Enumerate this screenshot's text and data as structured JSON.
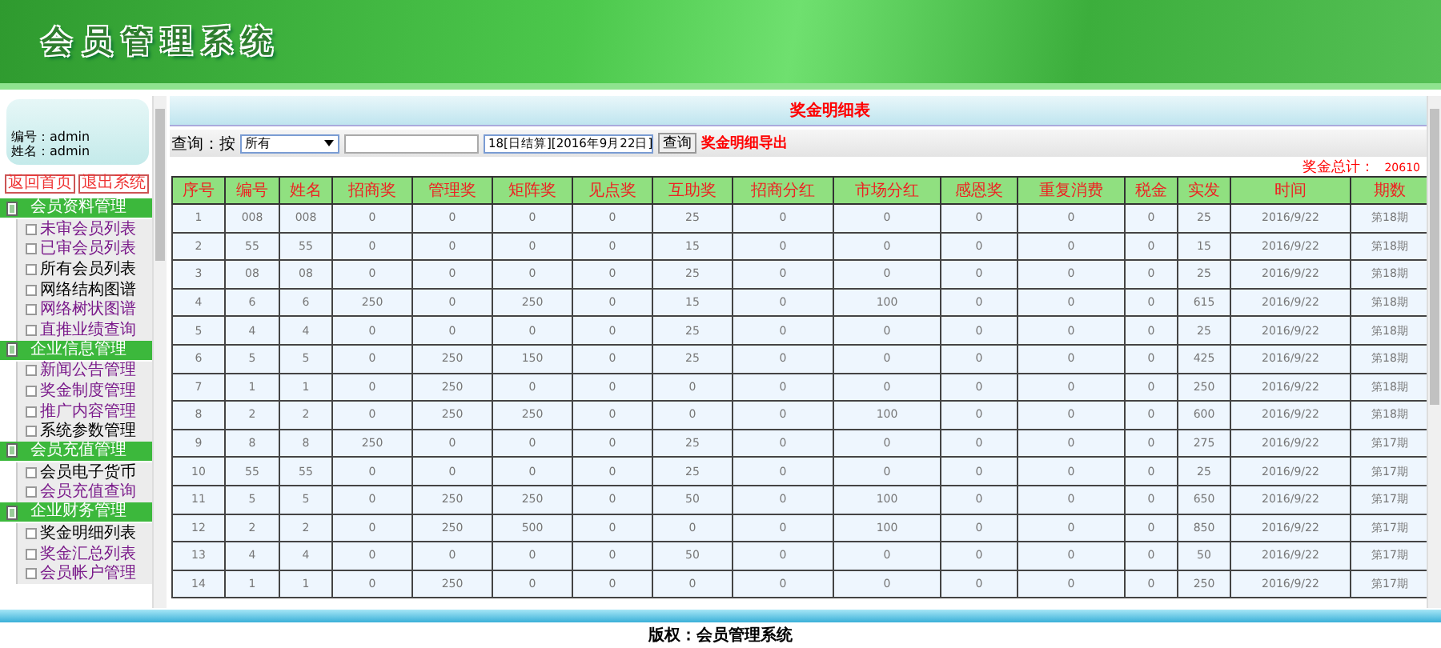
{
  "header": {
    "title": "会员管理系统"
  },
  "sidebar": {
    "user_lines": [
      "编号：admin",
      "姓名：admin"
    ],
    "buttons": [
      "返回首页",
      "退出系统"
    ],
    "groups": [
      {
        "title": "会员资料管理",
        "items": [
          {
            "label": "未审会员列表",
            "visited": true
          },
          {
            "label": "已审会员列表",
            "visited": true
          },
          {
            "label": "所有会员列表",
            "visited": false
          },
          {
            "label": "网络结构图谱",
            "visited": false
          },
          {
            "label": "网络树状图谱",
            "visited": true
          },
          {
            "label": "直推业绩查询",
            "visited": true
          }
        ]
      },
      {
        "title": "企业信息管理",
        "items": [
          {
            "label": "新闻公告管理",
            "visited": true
          },
          {
            "label": "奖金制度管理",
            "visited": true
          },
          {
            "label": "推广内容管理",
            "visited": true
          },
          {
            "label": "系统参数管理",
            "visited": false
          }
        ]
      },
      {
        "title": "会员充值管理",
        "items": [
          {
            "label": "会员电子货币",
            "visited": false
          },
          {
            "label": "会员充值查询",
            "visited": true
          }
        ]
      },
      {
        "title": "企业财务管理",
        "items": [
          {
            "label": "奖金明细列表",
            "visited": false
          },
          {
            "label": "奖金汇总列表",
            "visited": true
          },
          {
            "label": "会员帐户管理",
            "visited": true
          }
        ]
      }
    ]
  },
  "panel": {
    "title": "奖金明细表",
    "filter": {
      "label": "查询：按",
      "field_select": "所有",
      "period_select": "18[日结算][2016年9月22日]",
      "query_button": "查询",
      "export_link": "奖金明细导出"
    },
    "total": {
      "label": "奖金总计：",
      "value": "20610"
    },
    "table": {
      "columns": [
        "序号",
        "编号",
        "姓名",
        "招商奖",
        "管理奖",
        "矩阵奖",
        "见点奖",
        "互助奖",
        "招商分红",
        "市场分红",
        "感恩奖",
        "重复消费",
        "税金",
        "实发",
        "时间",
        "期数"
      ],
      "rows": [
        [
          "1",
          "008",
          "008",
          "0",
          "0",
          "0",
          "0",
          "25",
          "0",
          "0",
          "0",
          "0",
          "0",
          "25",
          "2016/9/22",
          "第18期"
        ],
        [
          "2",
          "55",
          "55",
          "0",
          "0",
          "0",
          "0",
          "15",
          "0",
          "0",
          "0",
          "0",
          "0",
          "15",
          "2016/9/22",
          "第18期"
        ],
        [
          "3",
          "08",
          "08",
          "0",
          "0",
          "0",
          "0",
          "25",
          "0",
          "0",
          "0",
          "0",
          "0",
          "25",
          "2016/9/22",
          "第18期"
        ],
        [
          "4",
          "6",
          "6",
          "250",
          "0",
          "250",
          "0",
          "15",
          "0",
          "100",
          "0",
          "0",
          "0",
          "615",
          "2016/9/22",
          "第18期"
        ],
        [
          "5",
          "4",
          "4",
          "0",
          "0",
          "0",
          "0",
          "25",
          "0",
          "0",
          "0",
          "0",
          "0",
          "25",
          "2016/9/22",
          "第18期"
        ],
        [
          "6",
          "5",
          "5",
          "0",
          "250",
          "150",
          "0",
          "25",
          "0",
          "0",
          "0",
          "0",
          "0",
          "425",
          "2016/9/22",
          "第18期"
        ],
        [
          "7",
          "1",
          "1",
          "0",
          "250",
          "0",
          "0",
          "0",
          "0",
          "0",
          "0",
          "0",
          "0",
          "250",
          "2016/9/22",
          "第18期"
        ],
        [
          "8",
          "2",
          "2",
          "0",
          "250",
          "250",
          "0",
          "0",
          "0",
          "100",
          "0",
          "0",
          "0",
          "600",
          "2016/9/22",
          "第18期"
        ],
        [
          "9",
          "8",
          "8",
          "250",
          "0",
          "0",
          "0",
          "25",
          "0",
          "0",
          "0",
          "0",
          "0",
          "275",
          "2016/9/22",
          "第17期"
        ],
        [
          "10",
          "55",
          "55",
          "0",
          "0",
          "0",
          "0",
          "25",
          "0",
          "0",
          "0",
          "0",
          "0",
          "25",
          "2016/9/22",
          "第17期"
        ],
        [
          "11",
          "5",
          "5",
          "0",
          "250",
          "250",
          "0",
          "50",
          "0",
          "100",
          "0",
          "0",
          "0",
          "650",
          "2016/9/22",
          "第17期"
        ],
        [
          "12",
          "2",
          "2",
          "0",
          "250",
          "500",
          "0",
          "0",
          "0",
          "100",
          "0",
          "0",
          "0",
          "850",
          "2016/9/22",
          "第17期"
        ],
        [
          "13",
          "4",
          "4",
          "0",
          "0",
          "0",
          "0",
          "50",
          "0",
          "0",
          "0",
          "0",
          "0",
          "50",
          "2016/9/22",
          "第17期"
        ],
        [
          "14",
          "1",
          "1",
          "0",
          "250",
          "0",
          "0",
          "0",
          "0",
          "0",
          "0",
          "0",
          "0",
          "250",
          "2016/9/22",
          "第17期"
        ]
      ]
    }
  },
  "footer": {
    "copyright": "版权：会员管理系统"
  }
}
